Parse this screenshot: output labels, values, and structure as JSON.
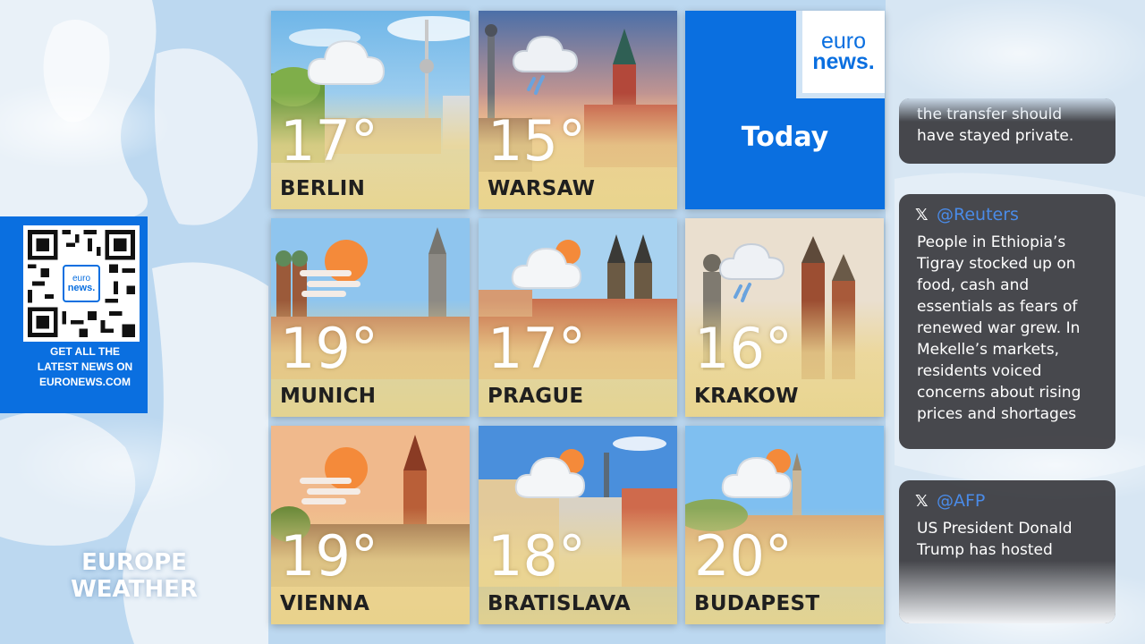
{
  "brand": {
    "logo_line1": "euro",
    "logo_line2": "news."
  },
  "qr": {
    "caption_lines": [
      "GET ALL THE",
      "LATEST NEWS ON",
      "EURONEWS.COM"
    ],
    "logo_line1": "euro",
    "logo_line2": "news."
  },
  "title_lines": [
    "EUROPE",
    "WEATHER"
  ],
  "today_label": "Today",
  "tiles": [
    {
      "city": "BERLIN",
      "temp": "17°",
      "icon": "cloud-icon"
    },
    {
      "city": "WARSAW",
      "temp": "15°",
      "icon": "rain-cloud-icon"
    },
    {
      "city": "MUNICH",
      "temp": "19°",
      "icon": "sun-haze-icon"
    },
    {
      "city": "PRAGUE",
      "temp": "17°",
      "icon": "partly-cloudy-icon"
    },
    {
      "city": "KRAKOW",
      "temp": "16°",
      "icon": "rain-cloud-icon"
    },
    {
      "city": "VIENNA",
      "temp": "19°",
      "icon": "sun-haze-icon"
    },
    {
      "city": "BRATISLAVA",
      "temp": "18°",
      "icon": "partly-cloudy-icon"
    },
    {
      "city": "BUDAPEST",
      "temp": "20°",
      "icon": "partly-cloudy-icon"
    }
  ],
  "tweets": [
    {
      "handle": "",
      "lines": [
        "the transfer should",
        "have stayed private."
      ]
    },
    {
      "handle": "@Reuters",
      "lines": [
        "People in Ethiopia’s",
        "Tigray stocked up on",
        "food, cash and",
        "essentials as fears of",
        "renewed war grew. In",
        "Mekelle’s markets,",
        "residents voiced",
        "concerns about rising",
        "prices and shortages"
      ]
    },
    {
      "handle": "@AFP",
      "lines": [
        "US President Donald",
        "Trump has hosted"
      ]
    }
  ],
  "colors": {
    "brand_blue": "#0a6fe0",
    "tile_fade": "#e8d48c",
    "tweet_bg": "#3a3a3e",
    "handle": "#4a8be8"
  }
}
